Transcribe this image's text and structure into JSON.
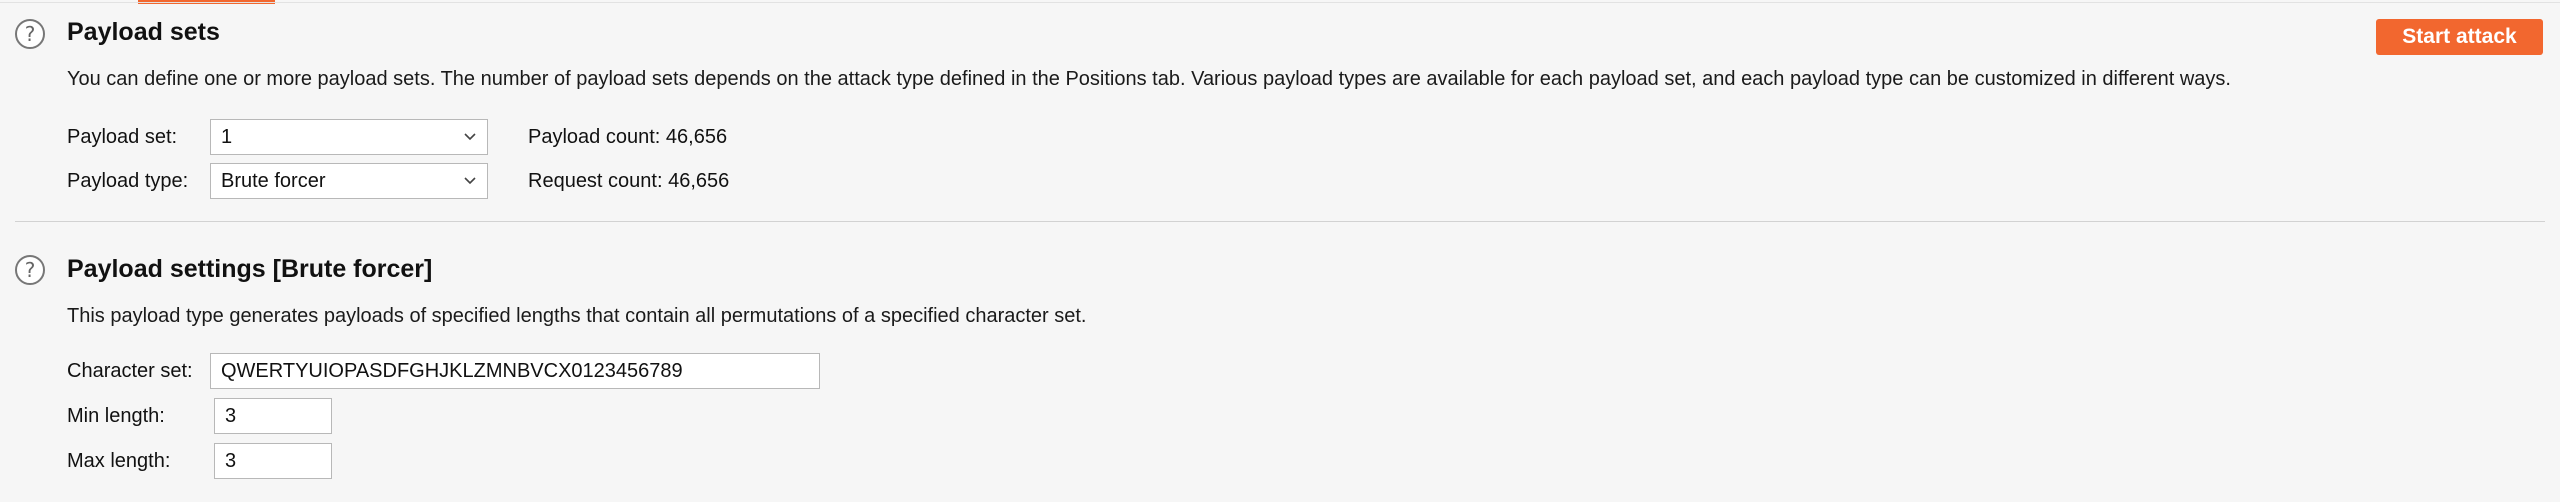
{
  "payload_sets": {
    "title": "Payload sets",
    "description": "You can define one or more payload sets. The number of payload sets depends on the attack type defined in the Positions tab. Various payload types are available for each payload set, and each payload type can be customized in different ways.",
    "start_attack_label": "Start attack",
    "payload_set_label": "Payload set:",
    "payload_set_value": "1",
    "payload_type_label": "Payload type:",
    "payload_type_value": "Brute forcer",
    "payload_count_label": "Payload count:",
    "payload_count_value": "46,656",
    "request_count_label": "Request count:",
    "request_count_value": "46,656"
  },
  "payload_settings": {
    "title": "Payload settings [Brute forcer]",
    "description": "This payload type generates payloads of specified lengths that contain all permutations of a specified character set.",
    "character_set_label": "Character set:",
    "character_set_value": "QWERTYUIOPASDFGHJKLZMNBVCX0123456789",
    "min_length_label": "Min length:",
    "min_length_value": "3",
    "max_length_label": "Max length:",
    "max_length_value": "3"
  },
  "icons": {
    "help": "?"
  },
  "colors": {
    "accent": "#f2672f",
    "background": "#f6f6f6"
  }
}
